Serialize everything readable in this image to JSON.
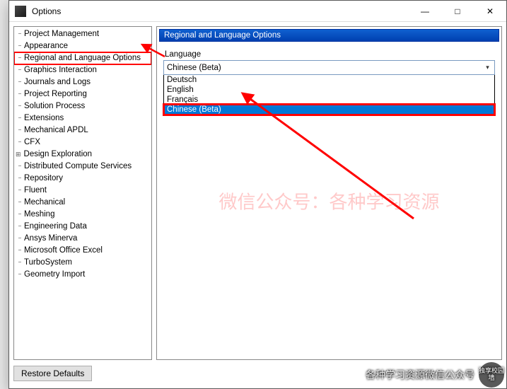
{
  "window": {
    "title": "Options"
  },
  "sidebar": {
    "items": [
      {
        "label": "Project Management",
        "expand": false
      },
      {
        "label": "Appearance",
        "expand": false
      },
      {
        "label": "Regional and Language Options",
        "expand": false,
        "highlighted": true
      },
      {
        "label": "Graphics Interaction",
        "expand": false
      },
      {
        "label": "Journals and Logs",
        "expand": false
      },
      {
        "label": "Project Reporting",
        "expand": false
      },
      {
        "label": "Solution Process",
        "expand": false
      },
      {
        "label": "Extensions",
        "expand": false
      },
      {
        "label": "Mechanical APDL",
        "expand": false
      },
      {
        "label": "CFX",
        "expand": false
      },
      {
        "label": "Design Exploration",
        "expand": true
      },
      {
        "label": "Distributed Compute Services",
        "expand": false
      },
      {
        "label": "Repository",
        "expand": false
      },
      {
        "label": "Fluent",
        "expand": false
      },
      {
        "label": "Mechanical",
        "expand": false
      },
      {
        "label": "Meshing",
        "expand": false
      },
      {
        "label": "Engineering Data",
        "expand": false
      },
      {
        "label": "Ansys Minerva",
        "expand": false
      },
      {
        "label": "Microsoft Office Excel",
        "expand": false
      },
      {
        "label": "TurboSystem",
        "expand": false
      },
      {
        "label": "Geometry Import",
        "expand": false
      }
    ]
  },
  "panel": {
    "header": "Regional and Language Options",
    "language_label": "Language",
    "language_value": "Chinese (Beta)",
    "dropdown_options": [
      {
        "label": "Deutsch",
        "selected": false
      },
      {
        "label": "English",
        "selected": false
      },
      {
        "label": "Français",
        "selected": false
      },
      {
        "label": "Chinese (Beta)",
        "selected": true,
        "highlighted": true
      }
    ]
  },
  "footer": {
    "restore_defaults": "Restore Defaults"
  },
  "watermark": {
    "center": "微信公众号：各种学习资源",
    "corner_text": "各种学习资源微信公众号",
    "corner_badge": "独享校园墙"
  }
}
